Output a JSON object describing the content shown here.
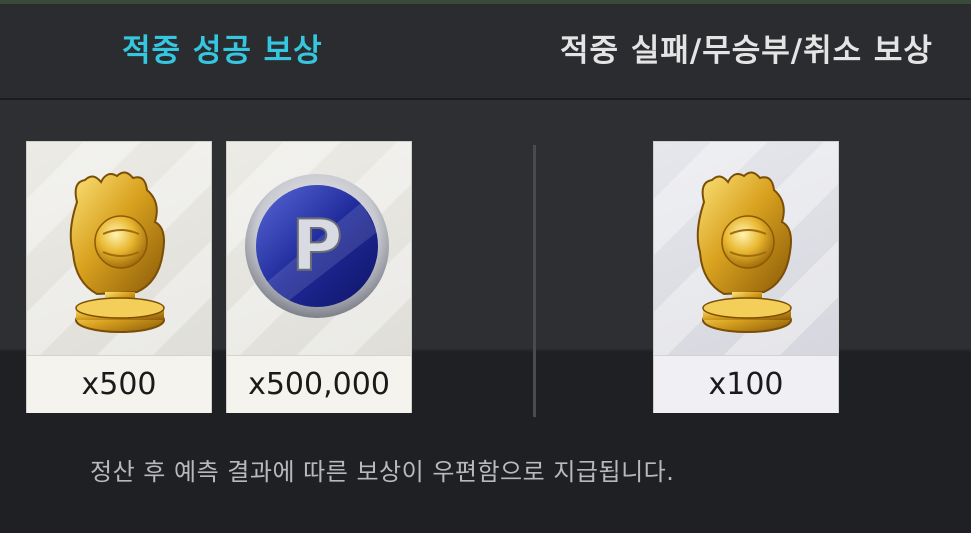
{
  "tabs": {
    "success_label": "적중 성공 보상",
    "fail_label": "적중 실패/무승부/취소 보상"
  },
  "rewards_success": [
    {
      "icon": "golden-glove-icon",
      "quantity": "x500"
    },
    {
      "icon": "p-coin-icon",
      "quantity": "x500,000"
    }
  ],
  "rewards_fail": [
    {
      "icon": "golden-glove-icon",
      "quantity": "x100"
    }
  ],
  "notice": "정산 후 예측 결과에 따른 보상이 우편함으로 지급됩니다.",
  "colors": {
    "active_tab": "#35c6e0",
    "inactive_tab": "#e4e4e4",
    "background": "#2e2f33"
  }
}
